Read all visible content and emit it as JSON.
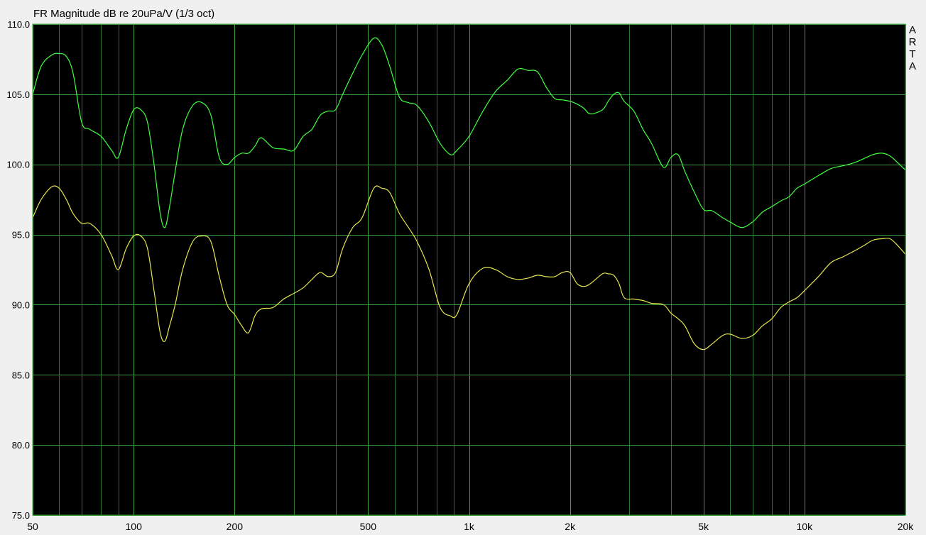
{
  "chart_data": {
    "type": "line",
    "title": "FR Magnitude dB re 20uPa/V (1/3 oct)",
    "xlabel": "",
    "ylabel": "",
    "xscale": "log",
    "xlim": [
      50,
      20000
    ],
    "ylim": [
      75,
      110
    ],
    "grid": true,
    "background": "#000000",
    "grid_color": "#3c9b3c",
    "y_ticks": [
      75,
      80,
      85,
      90,
      95,
      100,
      105,
      110
    ],
    "y_tick_labels": [
      "75.0",
      "80.0",
      "85.0",
      "90.0",
      "95.0",
      "100.0",
      "105.0",
      "110.0"
    ],
    "x_ticks": [
      50,
      100,
      200,
      500,
      1000,
      2000,
      5000,
      10000,
      20000
    ],
    "x_tick_labels": [
      "50",
      "100",
      "200",
      "500",
      "1k",
      "2k",
      "5k",
      "10k",
      "20k"
    ],
    "brand_letters": [
      "A",
      "R",
      "T",
      "A"
    ],
    "series": [
      {
        "color": "#40ff40",
        "x": [
          50,
          53,
          57,
          60,
          63,
          66,
          70,
          74,
          80,
          86,
          90,
          95,
          100,
          105,
          110,
          115,
          120,
          124,
          128,
          133,
          140,
          150,
          160,
          170,
          180,
          190,
          200,
          210,
          220,
          230,
          240,
          260,
          280,
          300,
          320,
          340,
          360,
          380,
          400,
          420,
          450,
          480,
          520,
          550,
          580,
          620,
          660,
          700,
          760,
          820,
          880,
          920,
          1000,
          1100,
          1200,
          1300,
          1400,
          1500,
          1600,
          1700,
          1800,
          1900,
          2000,
          2100,
          2200,
          2300,
          2500,
          2600,
          2700,
          2800,
          2900,
          3100,
          3300,
          3500,
          3800,
          4000,
          4200,
          4400,
          4700,
          5000,
          5300,
          5700,
          6000,
          6500,
          7000,
          7500,
          8000,
          8500,
          9000,
          9500,
          10000,
          11000,
          12000,
          13000,
          14000,
          15000,
          16000,
          17000,
          18000,
          19000,
          20000
        ],
        "values": [
          105.0,
          107.0,
          107.8,
          107.9,
          107.7,
          106.5,
          103.0,
          102.5,
          102.0,
          101.0,
          100.5,
          102.5,
          103.9,
          103.9,
          103.0,
          100.0,
          96.5,
          95.5,
          97.0,
          99.5,
          102.5,
          104.2,
          104.4,
          103.5,
          100.5,
          100.0,
          100.5,
          100.8,
          100.8,
          101.3,
          101.9,
          101.2,
          101.1,
          101.0,
          102.0,
          102.5,
          103.5,
          103.8,
          103.9,
          105.0,
          106.5,
          107.8,
          109.0,
          108.5,
          107.0,
          104.8,
          104.4,
          104.2,
          103.0,
          101.5,
          100.7,
          101.0,
          102.0,
          103.8,
          105.2,
          106.0,
          106.8,
          106.7,
          106.6,
          105.5,
          104.7,
          104.6,
          104.5,
          104.3,
          104.0,
          103.6,
          103.9,
          104.5,
          105.0,
          105.1,
          104.5,
          103.8,
          102.5,
          101.5,
          99.8,
          100.5,
          100.7,
          99.5,
          98.0,
          96.8,
          96.7,
          96.2,
          95.9,
          95.5,
          95.9,
          96.6,
          97.0,
          97.4,
          97.7,
          98.3,
          98.6,
          99.2,
          99.7,
          99.9,
          100.1,
          100.4,
          100.7,
          100.8,
          100.6,
          100.1,
          99.6
        ]
      },
      {
        "color": "#e6e650",
        "x": [
          50,
          53,
          57,
          60,
          63,
          66,
          70,
          74,
          80,
          86,
          90,
          95,
          100,
          105,
          110,
          115,
          120,
          124,
          128,
          133,
          140,
          150,
          160,
          170,
          180,
          190,
          200,
          210,
          220,
          230,
          240,
          260,
          280,
          300,
          320,
          340,
          360,
          380,
          400,
          420,
          450,
          480,
          520,
          550,
          580,
          620,
          660,
          700,
          760,
          820,
          880,
          920,
          1000,
          1100,
          1200,
          1300,
          1400,
          1500,
          1600,
          1700,
          1800,
          1900,
          2000,
          2100,
          2200,
          2300,
          2500,
          2600,
          2700,
          2800,
          2900,
          3100,
          3300,
          3500,
          3800,
          4000,
          4200,
          4400,
          4700,
          5000,
          5300,
          5700,
          6000,
          6500,
          7000,
          7500,
          8000,
          8500,
          9000,
          9500,
          10000,
          11000,
          12000,
          13000,
          14000,
          15000,
          16000,
          17000,
          18000,
          19000,
          20000
        ],
        "values": [
          96.2,
          97.5,
          98.4,
          98.3,
          97.5,
          96.5,
          95.8,
          95.8,
          95.0,
          93.5,
          92.5,
          94.0,
          94.9,
          94.9,
          94.0,
          91.0,
          88.0,
          87.4,
          88.5,
          90.0,
          92.5,
          94.5,
          94.9,
          94.5,
          92.0,
          90.0,
          89.3,
          88.5,
          88.0,
          89.2,
          89.7,
          89.8,
          90.4,
          90.8,
          91.2,
          91.8,
          92.3,
          92.0,
          92.3,
          94.0,
          95.5,
          96.2,
          98.3,
          98.3,
          98.0,
          96.5,
          95.5,
          94.5,
          92.5,
          89.8,
          89.2,
          89.3,
          91.5,
          92.6,
          92.5,
          92.0,
          91.8,
          91.9,
          92.1,
          92.0,
          92.0,
          92.3,
          92.3,
          91.5,
          91.3,
          91.5,
          92.2,
          92.2,
          92.1,
          91.5,
          90.5,
          90.4,
          90.3,
          90.1,
          90.0,
          89.4,
          89.0,
          88.5,
          87.2,
          86.8,
          87.2,
          87.8,
          87.9,
          87.6,
          87.8,
          88.5,
          89.0,
          89.8,
          90.2,
          90.5,
          91.0,
          92.0,
          93.0,
          93.4,
          93.8,
          94.2,
          94.6,
          94.7,
          94.7,
          94.2,
          93.6
        ]
      }
    ]
  }
}
